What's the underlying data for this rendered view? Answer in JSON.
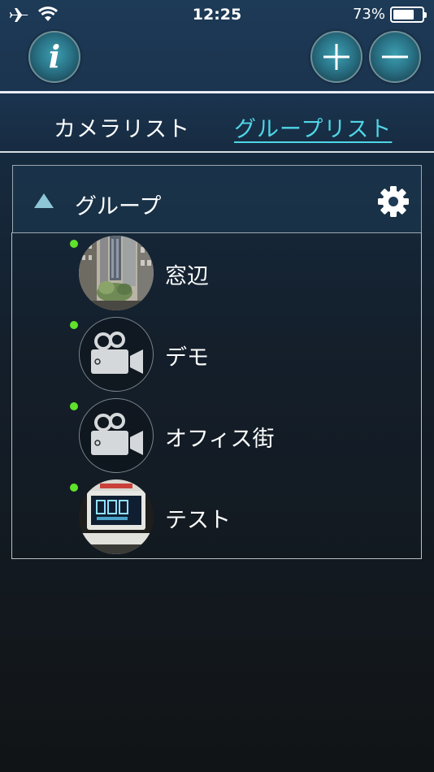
{
  "status_bar": {
    "time": "12:25",
    "battery_percent": "73%",
    "battery_level": 0.73
  },
  "nav": {
    "info_label": "i"
  },
  "tabs": [
    {
      "label": "カメラリスト",
      "selected": false
    },
    {
      "label": "グループリスト",
      "selected": true
    }
  ],
  "group": {
    "name": "グループ",
    "expanded": true,
    "cameras": [
      {
        "name": "窓辺",
        "online": true,
        "thumbnail": "window-view-photo"
      },
      {
        "name": "デモ",
        "online": true,
        "thumbnail": "camera-icon"
      },
      {
        "name": "オフィス街",
        "online": true,
        "thumbnail": "camera-icon"
      },
      {
        "name": "テスト",
        "online": true,
        "thumbnail": "clock-photo"
      }
    ]
  },
  "colors": {
    "accent_tab": "#4fd6e6",
    "online_dot": "#5ee32a",
    "triangle": "#8dc6d6"
  }
}
